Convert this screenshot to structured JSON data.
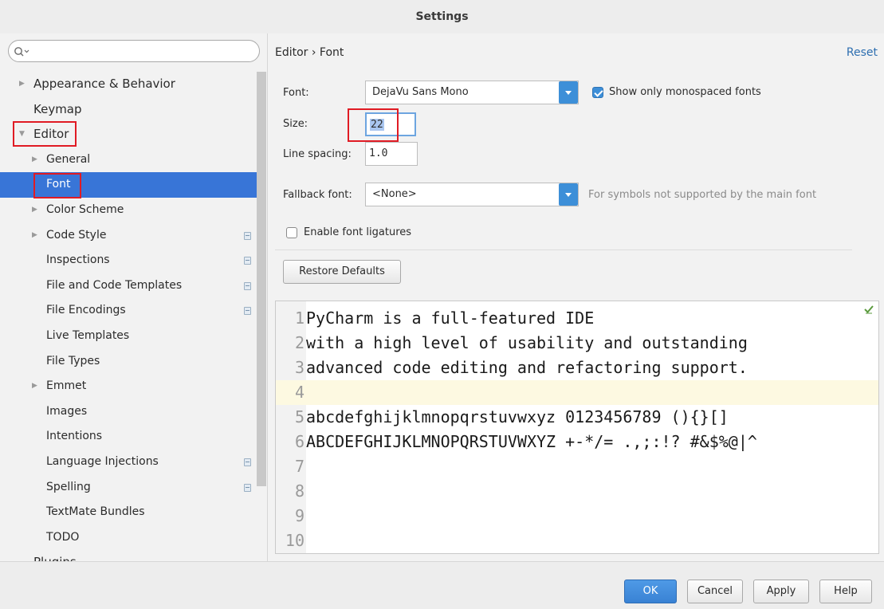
{
  "window": {
    "title": "Settings"
  },
  "search": {
    "placeholder": ""
  },
  "sidebar": {
    "items": [
      {
        "label": "Appearance & Behavior",
        "level": 0,
        "arrow": "▶",
        "proj": false
      },
      {
        "label": "Keymap",
        "level": 0,
        "arrow": "",
        "proj": false
      },
      {
        "label": "Editor",
        "level": 0,
        "arrow": "▼",
        "proj": false
      },
      {
        "label": "General",
        "level": 1,
        "arrow": "▶",
        "proj": false
      },
      {
        "label": "Font",
        "level": 1,
        "arrow": "",
        "proj": false,
        "selected": true
      },
      {
        "label": "Color Scheme",
        "level": 1,
        "arrow": "▶",
        "proj": false
      },
      {
        "label": "Code Style",
        "level": 1,
        "arrow": "▶",
        "proj": true
      },
      {
        "label": "Inspections",
        "level": 1,
        "arrow": "",
        "proj": true
      },
      {
        "label": "File and Code Templates",
        "level": 1,
        "arrow": "",
        "proj": true
      },
      {
        "label": "File Encodings",
        "level": 1,
        "arrow": "",
        "proj": true
      },
      {
        "label": "Live Templates",
        "level": 1,
        "arrow": "",
        "proj": false
      },
      {
        "label": "File Types",
        "level": 1,
        "arrow": "",
        "proj": false
      },
      {
        "label": "Emmet",
        "level": 1,
        "arrow": "▶",
        "proj": false
      },
      {
        "label": "Images",
        "level": 1,
        "arrow": "",
        "proj": false
      },
      {
        "label": "Intentions",
        "level": 1,
        "arrow": "",
        "proj": false
      },
      {
        "label": "Language Injections",
        "level": 1,
        "arrow": "",
        "proj": true
      },
      {
        "label": "Spelling",
        "level": 1,
        "arrow": "",
        "proj": true
      },
      {
        "label": "TextMate Bundles",
        "level": 1,
        "arrow": "",
        "proj": false
      },
      {
        "label": "TODO",
        "level": 1,
        "arrow": "",
        "proj": false
      },
      {
        "label": "Plugins",
        "level": 0,
        "arrow": "",
        "proj": false
      }
    ]
  },
  "header": {
    "breadcrumb": "Editor › Font",
    "reset": "Reset"
  },
  "form": {
    "font_label": "Font:",
    "font_value": "DejaVu Sans Mono",
    "monospaced_label": "Show only monospaced fonts",
    "monospaced_checked": true,
    "size_label": "Size:",
    "size_value": "22",
    "line_spacing_label": "Line spacing:",
    "line_spacing_value": "1.0",
    "fallback_label": "Fallback font:",
    "fallback_value": "<None>",
    "fallback_hint": "For symbols not supported by the main font",
    "ligatures_label": "Enable font ligatures",
    "ligatures_checked": false,
    "restore_label": "Restore Defaults"
  },
  "preview": {
    "lines": [
      {
        "n": "1",
        "text": "PyCharm is a full-featured IDE"
      },
      {
        "n": "2",
        "text": "with a high level of usability and outstanding"
      },
      {
        "n": "3",
        "text": "advanced code editing and refactoring support."
      },
      {
        "n": "4",
        "text": ""
      },
      {
        "n": "5",
        "text": "abcdefghijklmnopqrstuvwxyz 0123456789 (){}[]"
      },
      {
        "n": "6",
        "text": "ABCDEFGHIJKLMNOPQRSTUVWXYZ +-*/= .,;:!? #&$%@|^"
      },
      {
        "n": "7",
        "text": ""
      },
      {
        "n": "8",
        "text": ""
      },
      {
        "n": "9",
        "text": ""
      },
      {
        "n": "10",
        "text": ""
      }
    ],
    "caret_line": 4
  },
  "footer": {
    "ok": "OK",
    "cancel": "Cancel",
    "apply": "Apply",
    "help": "Help"
  },
  "colors": {
    "accent": "#3875d7",
    "highlight_box": "#e01b24",
    "link": "#2e6fb0"
  }
}
